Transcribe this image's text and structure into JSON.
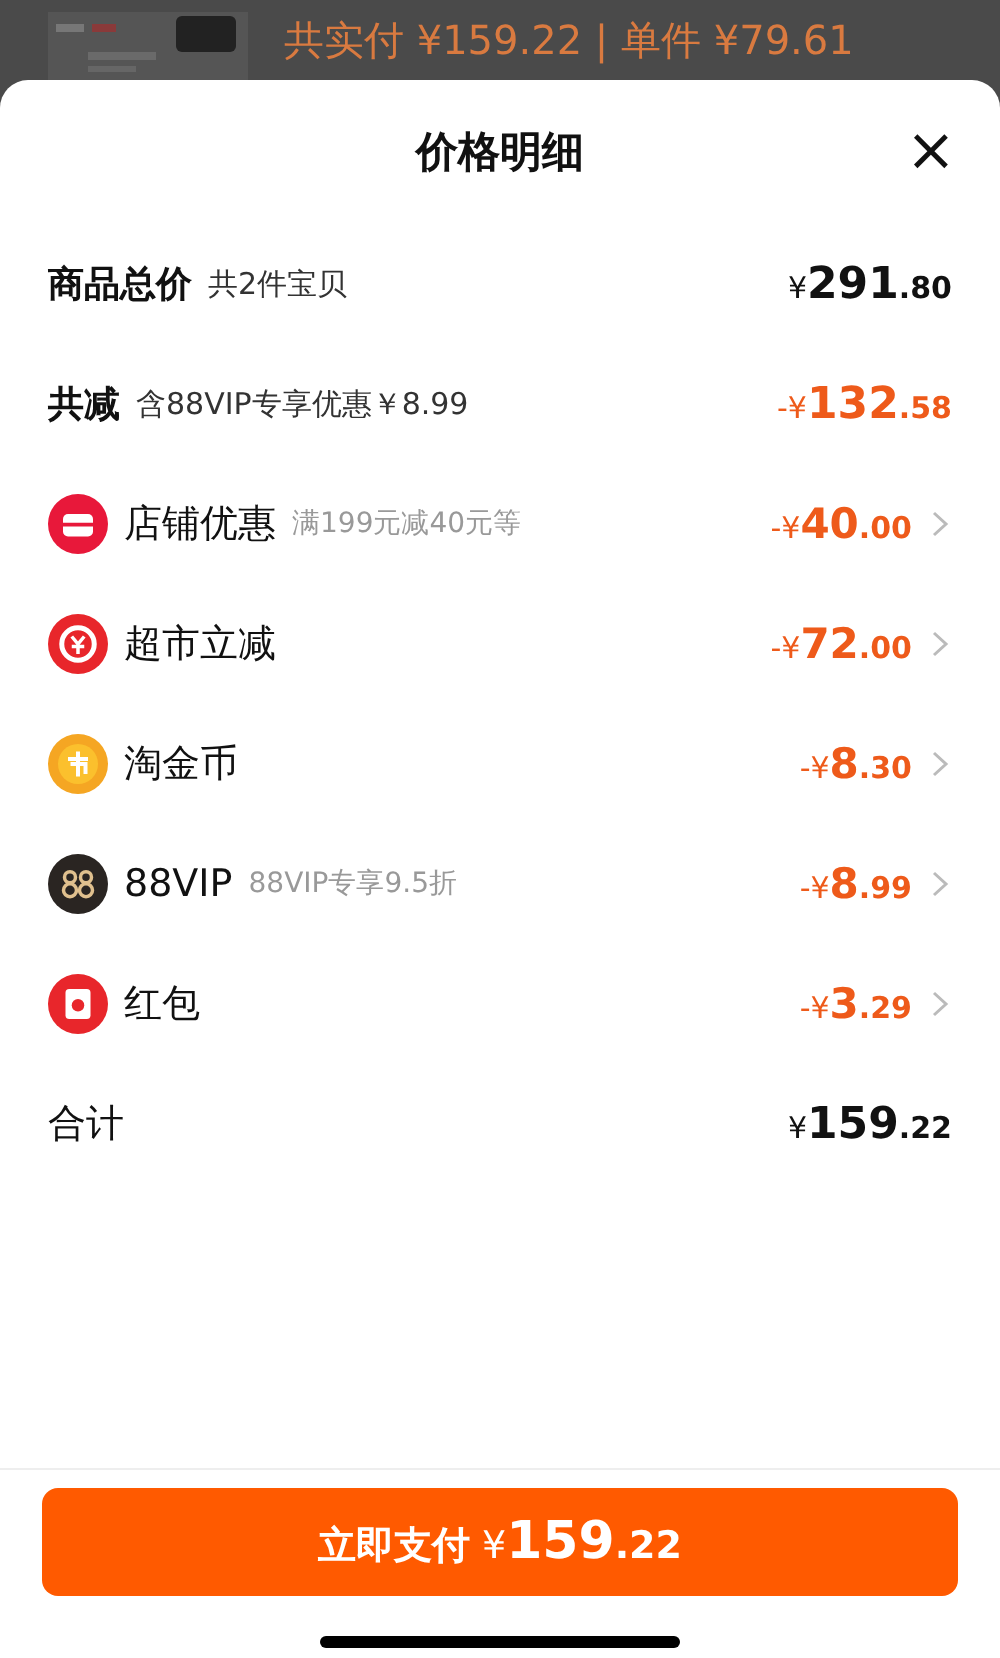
{
  "backdrop": {
    "summary": "共实付 ¥159.22 | 单件 ¥79.61"
  },
  "sheet": {
    "title": "价格明细",
    "close": "×"
  },
  "total": {
    "label": "商品总价",
    "note": "共2件宝贝",
    "amount": "¥291.80"
  },
  "reduction": {
    "label": "共减",
    "note": "含88VIP专享优惠￥8.99",
    "amount": "-¥132.58"
  },
  "discounts": [
    {
      "kind": "shop",
      "label": "店铺优惠",
      "note": "满199元减40元等",
      "amount": "-¥40.00",
      "color": "#e8183a"
    },
    {
      "kind": "market",
      "label": "超市立减",
      "amount": "-¥72.00",
      "color": "#e8262b"
    },
    {
      "kind": "coin",
      "label": "淘金币",
      "amount": "-¥8.30",
      "color": "#f5a623"
    },
    {
      "kind": "vip",
      "label": "88VIP",
      "note": "88VIP专享9.5折",
      "amount": "-¥8.99",
      "color": "#2a2522"
    },
    {
      "kind": "packet",
      "label": "红包",
      "amount": "-¥3.29",
      "color": "#e8262b"
    }
  ],
  "sum": {
    "label": "合计",
    "amount": "¥159.22"
  },
  "pay_button": {
    "label": "立即支付",
    "amount": "¥159.22"
  }
}
